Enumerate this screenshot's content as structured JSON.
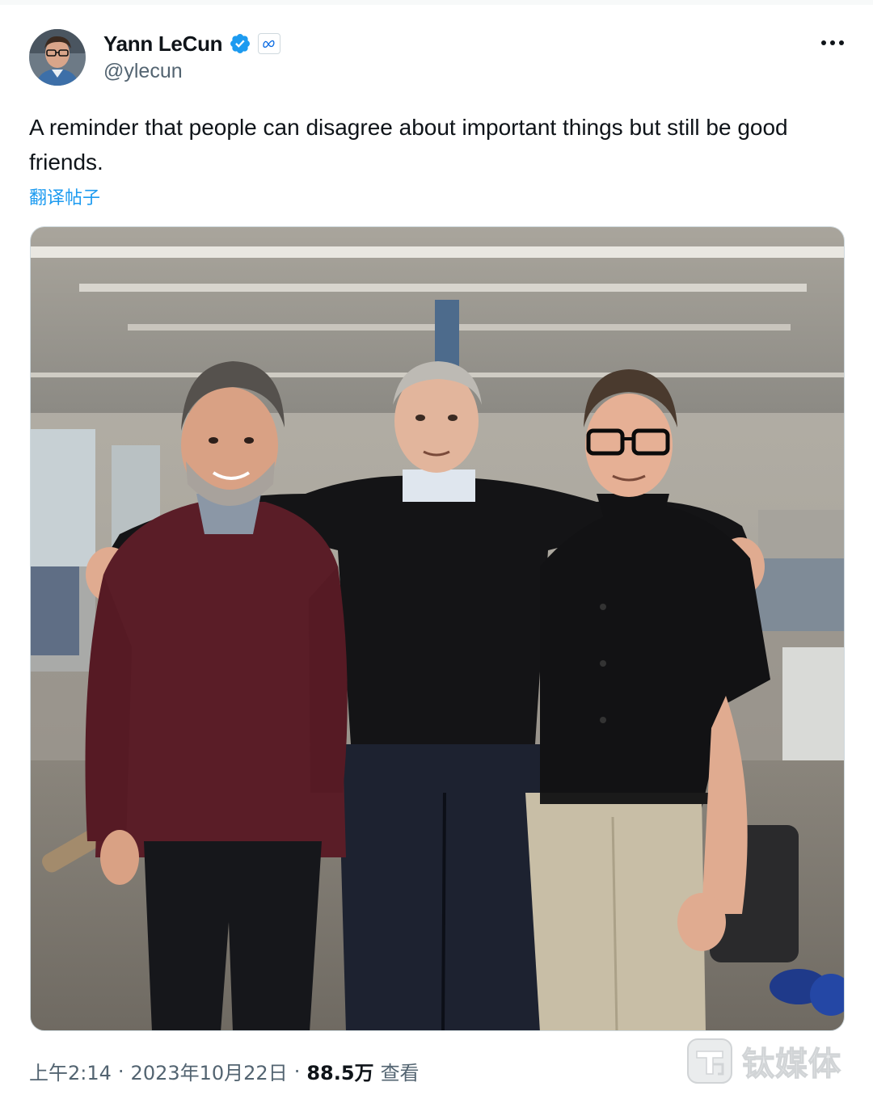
{
  "author": {
    "display_name": "Yann LeCun",
    "handle": "@ylecun",
    "verified": true,
    "affiliation": "Meta"
  },
  "tweet": {
    "text": "A reminder that people can disagree about important things but still be good friends.",
    "translate_label": "翻译帖子"
  },
  "meta": {
    "time": "上午2:14",
    "date": "2023年10月22日",
    "separator": "·",
    "views": "88.5万",
    "views_label": "查看"
  },
  "watermark": {
    "text": "钛媒体"
  },
  "colors": {
    "link": "#1d9bf0",
    "verified": "#1d9bf0",
    "secondary_text": "#536471"
  }
}
